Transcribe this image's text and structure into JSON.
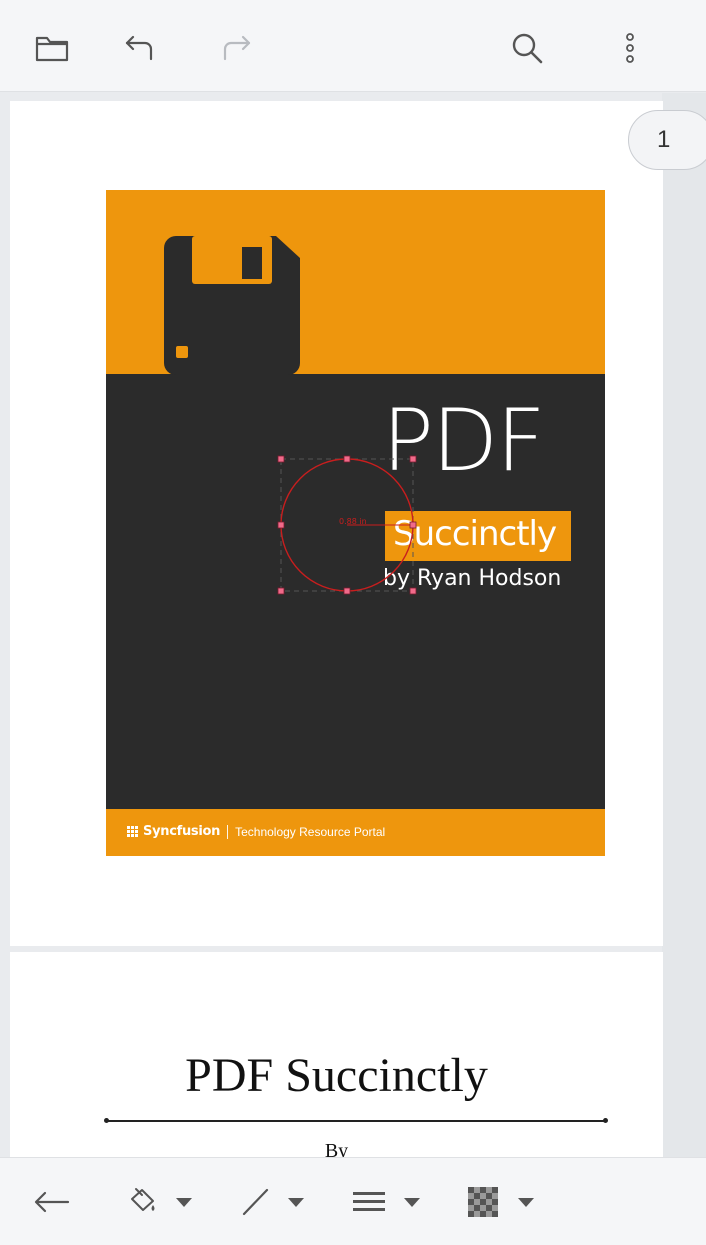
{
  "toolbar": {
    "icons": [
      "folder-icon",
      "undo-icon",
      "redo-icon",
      "search-icon",
      "more-vertical-icon"
    ]
  },
  "viewer": {
    "page_indicator": "1",
    "cover": {
      "title": "PDF",
      "subtitle": "Succinctly",
      "author": "by Ryan Hodson",
      "brand_name": "Syncfusion",
      "brand_tagline": "Technology Resource Portal",
      "colors": {
        "orange": "#ee960d",
        "dark": "#2b2b2b"
      }
    },
    "annotation": {
      "type": "circle",
      "measurement_label": "0.88 in",
      "stroke_color": "#c81e1e"
    },
    "page2": {
      "title": "PDF Succinctly",
      "by": "By"
    }
  },
  "bottom_toolbar": {
    "icons": [
      "back-arrow-icon",
      "fill-color-icon",
      "stroke-color-icon",
      "thickness-icon",
      "opacity-icon"
    ]
  }
}
